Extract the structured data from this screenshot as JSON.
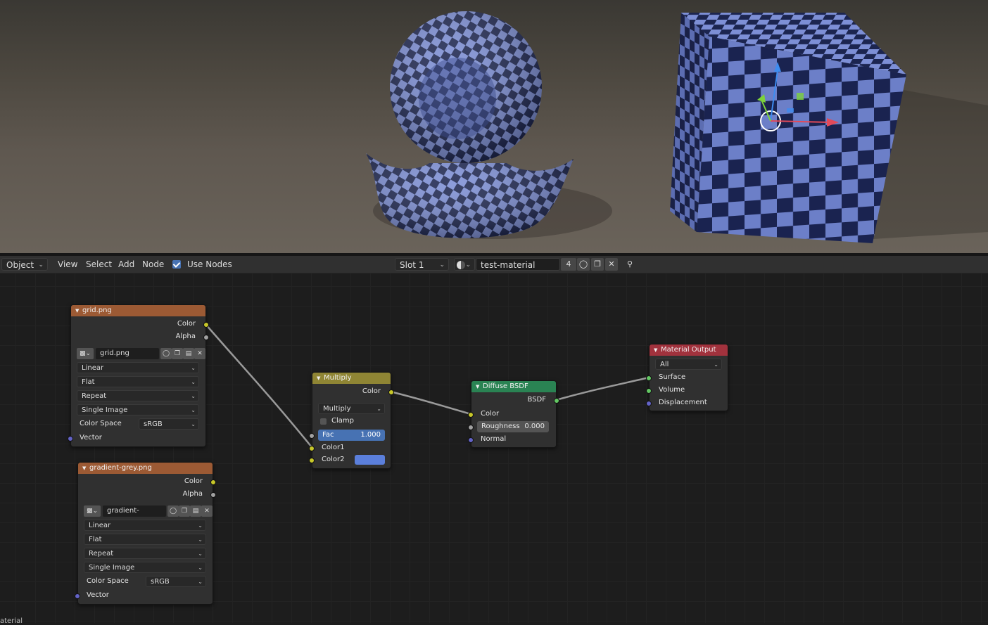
{
  "header": {
    "mode": "Object",
    "menus": [
      "View",
      "Select",
      "Add",
      "Node"
    ],
    "use_nodes_label": "Use Nodes",
    "slot": "Slot 1",
    "material_name": "test-material",
    "user_count": "4"
  },
  "nodes": {
    "grid": {
      "title": "grid.png",
      "out_color": "Color",
      "out_alpha": "Alpha",
      "image_name": "grid.png",
      "interpolation": "Linear",
      "projection": "Flat",
      "extension": "Repeat",
      "source": "Single Image",
      "color_space_label": "Color Space",
      "color_space": "sRGB",
      "in_vector": "Vector"
    },
    "gradient": {
      "title": "gradient-grey.png",
      "out_color": "Color",
      "out_alpha": "Alpha",
      "image_name": "gradient-grey.png",
      "interpolation": "Linear",
      "projection": "Flat",
      "extension": "Repeat",
      "source": "Single Image",
      "color_space_label": "Color Space",
      "color_space": "sRGB",
      "in_vector": "Vector"
    },
    "multiply": {
      "title": "Multiply",
      "out_color": "Color",
      "blend_type": "Multiply",
      "clamp_label": "Clamp",
      "fac_label": "Fac",
      "fac_value": "1.000",
      "color1_label": "Color1",
      "color2_label": "Color2",
      "color2_swatch": "#5b7fdb"
    },
    "diffuse": {
      "title": "Diffuse BSDF",
      "out_bsdf": "BSDF",
      "in_color": "Color",
      "roughness_label": "Roughness",
      "roughness_value": "0.000",
      "in_normal": "Normal"
    },
    "output": {
      "title": "Material Output",
      "target": "All",
      "in_surface": "Surface",
      "in_volume": "Volume",
      "in_displacement": "Displacement"
    }
  },
  "footer_text": "aterial",
  "colors": {
    "image_node_header": "#9c5a34",
    "mix_node_header": "#8f8534",
    "shader_node_header": "#2a8353",
    "output_node_header": "#a1323d",
    "accent": "#4772b3"
  }
}
